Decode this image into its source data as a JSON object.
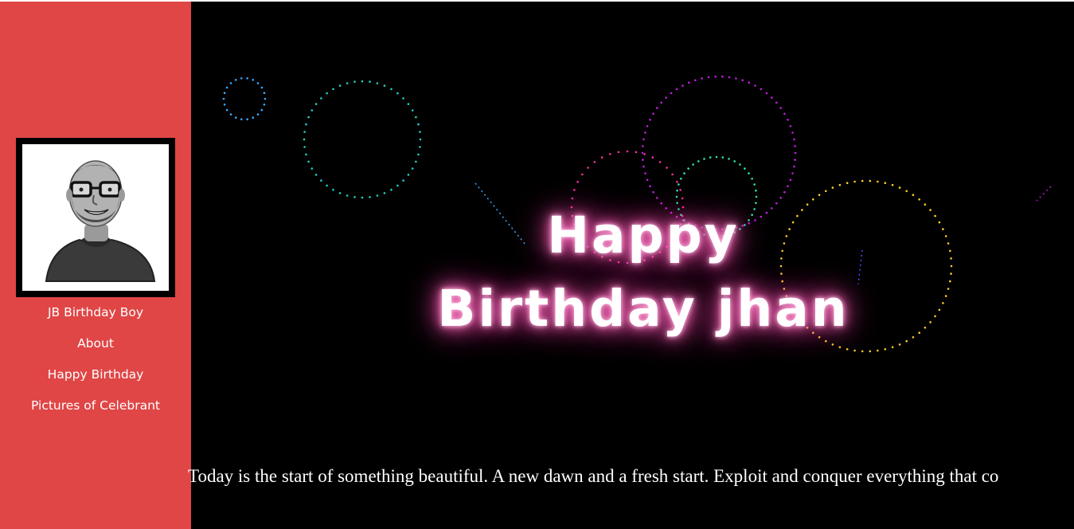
{
  "sidebar": {
    "background_color": "#e04646",
    "avatar": {
      "icon": "person-caricature-icon"
    },
    "nav_items": [
      {
        "label": "JB Birthday Boy"
      },
      {
        "label": "About"
      },
      {
        "label": "Happy Birthday"
      },
      {
        "label": "Pictures of Celebrant"
      }
    ]
  },
  "hero": {
    "background_color": "#000000",
    "title_line1": "Happy",
    "title_line2": "Birthday jhan",
    "glow_color": "#ff4fb0",
    "firework_colors": [
      "#3aa8ff",
      "#22d1c4",
      "#c21be0",
      "#ff2fa0",
      "#2fe0b0",
      "#ffcc22"
    ]
  },
  "marquee": {
    "text": "Today is the start of something beautiful. A new dawn and a fresh start. Exploit and conquer everything that co"
  }
}
